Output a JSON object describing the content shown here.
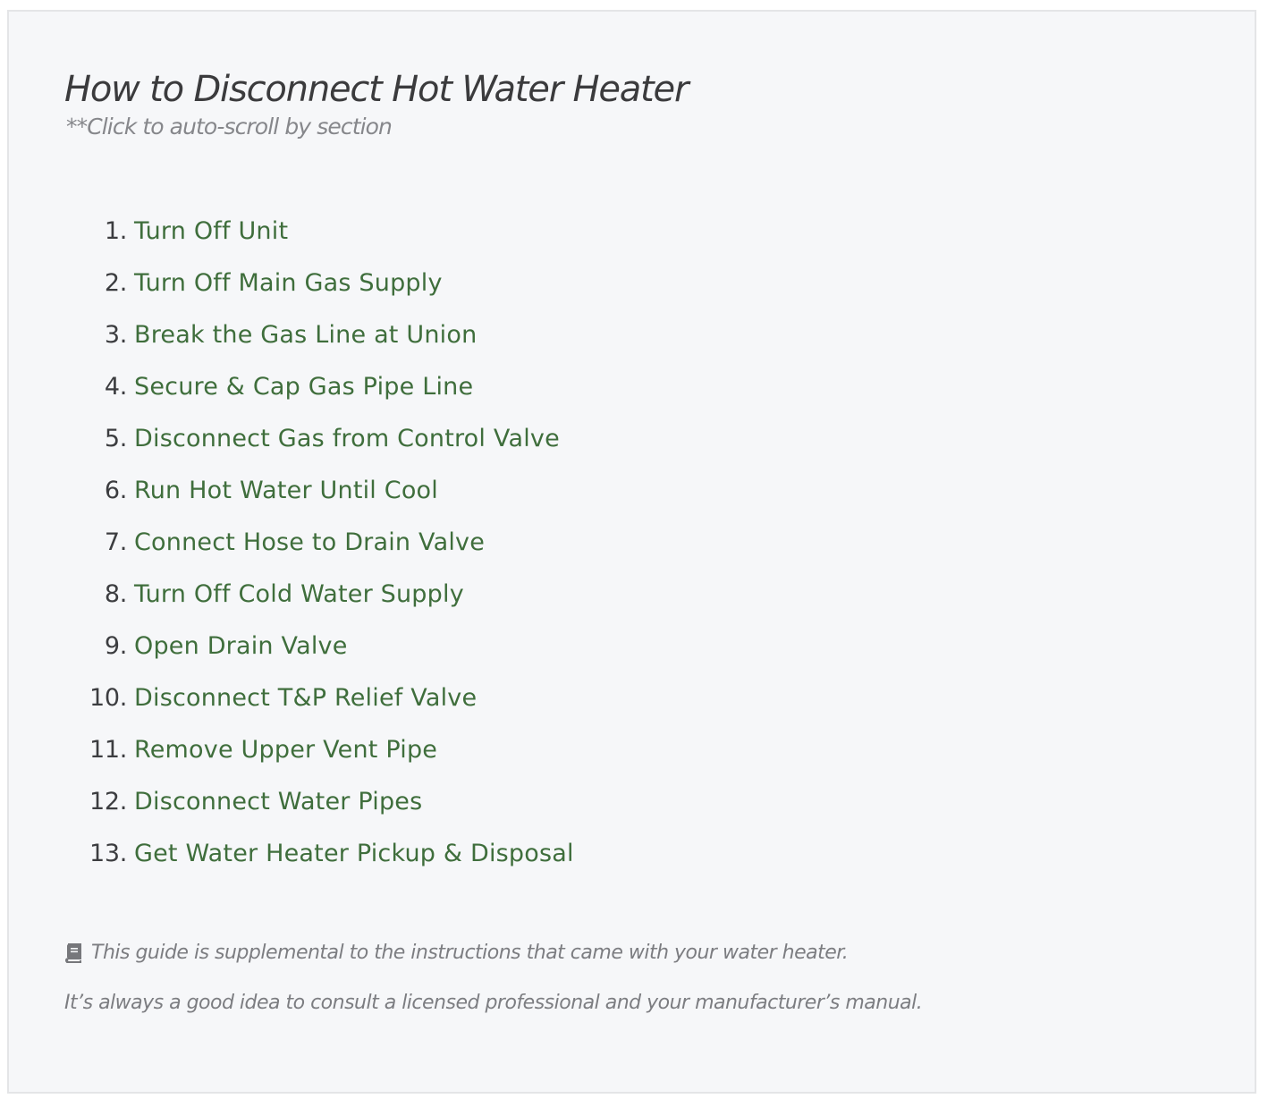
{
  "guide": {
    "title": "How to Disconnect Hot Water Heater",
    "subtitle": "**Click to auto-scroll by section",
    "steps": [
      {
        "num": "1.",
        "label": "Turn Off Unit"
      },
      {
        "num": "2.",
        "label": "Turn Off Main Gas Supply"
      },
      {
        "num": "3.",
        "label": "Break the Gas Line at Union"
      },
      {
        "num": "4.",
        "label": "Secure & Cap Gas Pipe Line"
      },
      {
        "num": "5.",
        "label": "Disconnect Gas from Control Valve"
      },
      {
        "num": "6.",
        "label": "Run Hot Water Until Cool"
      },
      {
        "num": "7.",
        "label": "Connect Hose to Drain Valve"
      },
      {
        "num": "8.",
        "label": "Turn Off Cold Water Supply"
      },
      {
        "num": "9.",
        "label": "Open Drain Valve"
      },
      {
        "num": "10.",
        "label": "Disconnect T&P Relief Valve"
      },
      {
        "num": "11.",
        "label": "Remove Upper Vent Pipe"
      },
      {
        "num": "12.",
        "label": "Disconnect Water Pipes"
      },
      {
        "num": "13.",
        "label": "Get Water Heater Pickup & Disposal"
      }
    ],
    "notes": {
      "icon": "book-icon",
      "supplemental": "This guide is supplemental to the instructions that came with your water heater.",
      "consult": "It’s always a good idea to consult a licensed professional and your manufacturer’s manual."
    },
    "colors": {
      "link": "#3f6e3c",
      "background": "#f6f7f9",
      "border": "#e4e5e7"
    }
  }
}
